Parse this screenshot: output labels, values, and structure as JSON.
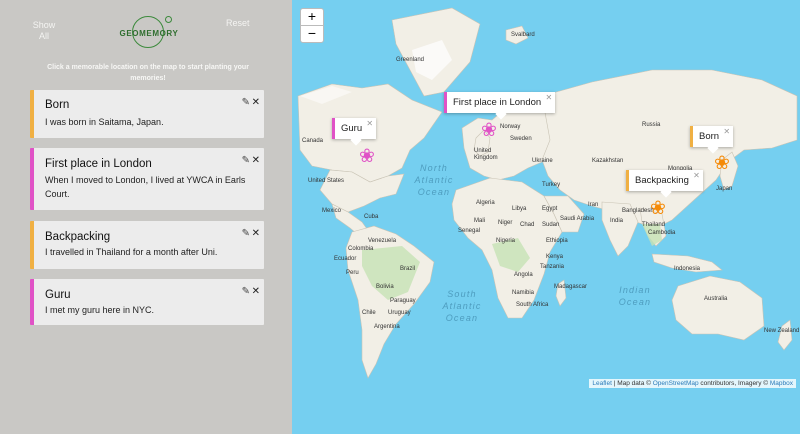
{
  "sidebar": {
    "show_all": "Show All",
    "reset": "Reset",
    "logo": "GEOMEMORY",
    "instructions": "Click a memorable location on the map to start planting your memories!",
    "cards": [
      {
        "title": "Born",
        "description": "I was born in Saitama, Japan.",
        "color": "#f0b043"
      },
      {
        "title": "First place in London",
        "description": "When I moved to London, I lived at YWCA in Earls Court.",
        "color": "#e052c6"
      },
      {
        "title": "Backpacking",
        "description": "I travelled in Thailand for a month after Uni.",
        "color": "#f0b043"
      },
      {
        "title": "Guru",
        "description": "I met my guru here in NYC.",
        "color": "#e052c6"
      }
    ],
    "edit_icon": "pencil-icon",
    "close_icon": "close-icon"
  },
  "map": {
    "zoom_in": "+",
    "zoom_out": "−",
    "oceans": [
      "North Atlantic Ocean",
      "South Atlantic Ocean",
      "Indian Ocean"
    ],
    "labels": {
      "svalbard": "Svalbard",
      "greenland": "Greenland",
      "canada": "Canada",
      "united_states": "United States",
      "mexico": "Mexico",
      "cuba": "Cuba",
      "venezuela": "Venezuela",
      "colombia": "Colombia",
      "ecuador": "Ecuador",
      "peru": "Peru",
      "brazil": "Brazil",
      "bolivia": "Bolivia",
      "paraguay": "Paraguay",
      "chile": "Chile",
      "argentina": "Argentina",
      "uruguay": "Uruguay",
      "norway": "Norway",
      "sweden": "Sweden",
      "united_kingdom": "United Kingdom",
      "ukraine": "Ukraine",
      "turkey": "Turkey",
      "russia": "Russia",
      "kazakhstan": "Kazakhstan",
      "mongolia": "Mongolia",
      "china": "China",
      "japan": "Japan",
      "iran": "Iran",
      "algeria": "Algeria",
      "libya": "Libya",
      "egypt": "Egypt",
      "mali": "Mali",
      "niger": "Niger",
      "chad": "Chad",
      "sudan": "Sudan",
      "nigeria": "Nigeria",
      "ethiopia": "Ethiopia",
      "senegal": "Senegal",
      "kenya": "Kenya",
      "tanzania": "Tanzania",
      "angola": "Angola",
      "namibia": "Namibia",
      "south_africa": "South Africa",
      "madagascar": "Madagascar",
      "india": "India",
      "bangladesh": "Bangladesh",
      "thailand": "Thailand",
      "cambodia": "Cambodia",
      "indonesia": "Indonesia",
      "australia": "Australia",
      "new_zealand": "New Zealand",
      "algeria2": "Saudi Arabia"
    },
    "popups": [
      {
        "title": "Guru",
        "color": "#e052c6"
      },
      {
        "title": "First place in London",
        "color": "#e052c6"
      },
      {
        "title": "Born",
        "color": "#f0b043"
      },
      {
        "title": "Backpacking",
        "color": "#f0b043"
      }
    ],
    "markers": [
      {
        "name": "guru",
        "color": "#e052c6"
      },
      {
        "name": "london",
        "color": "#e052c6"
      },
      {
        "name": "born",
        "color": "#f58a07"
      },
      {
        "name": "backpacking",
        "color": "#f58a07"
      }
    ],
    "flower_glyph": "❀",
    "attribution": {
      "leaflet": "Leaflet",
      "text1": " | Map data © ",
      "osm": "OpenStreetMap",
      "text2": " contributors, Imagery © ",
      "mapbox": "Mapbox"
    }
  }
}
